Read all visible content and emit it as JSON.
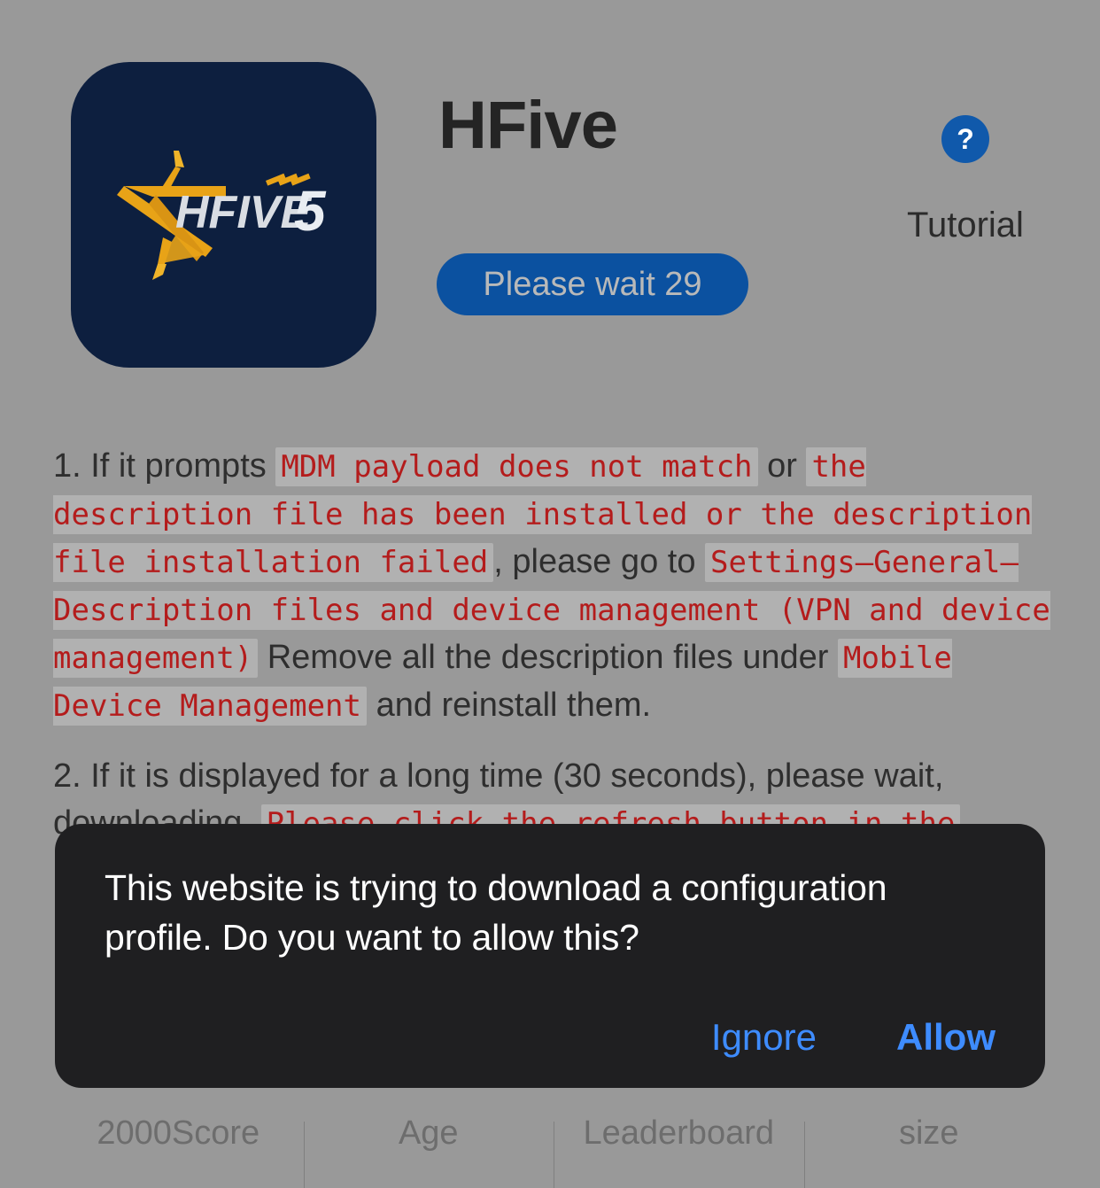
{
  "header": {
    "app_title": "HFive",
    "app_icon_name": "hfive5-logo",
    "icon_bg_color": "#0d1f3f",
    "icon_logo_text": "HFIVE",
    "icon_logo_number": "5",
    "wait_button_label": "Please wait 29",
    "wait_button_color": "#0b51a0",
    "help_icon_glyph": "?",
    "help_icon_color": "#1059ab",
    "tutorial_label": "Tutorial"
  },
  "instructions": {
    "item1": {
      "lead": "1. If it prompts",
      "code1": "MDM payload does not match",
      "conj": "or",
      "code2": "the description file has been installed or the description file installation failed",
      "mid1": ", please go to",
      "code3": "Settings—General—Description files and device management (VPN and device management)",
      "mid2": "Remove all the description files under",
      "code4": "Mobile Device Management",
      "tail": "and reinstall them."
    },
    "item2": {
      "lead": "2. If it is displayed for a long time (30 seconds), please wait, downloading.",
      "code1": "Please click the refresh button in the"
    }
  },
  "stats": {
    "columns": [
      {
        "label": "2000Score",
        "value": ""
      },
      {
        "label": "Age",
        "value": ""
      },
      {
        "label": "Leaderboard",
        "value": ""
      },
      {
        "label": "size",
        "value": ""
      }
    ]
  },
  "dialog": {
    "message": "This website is trying to download a configuration profile. Do you want to allow this?",
    "ignore_label": "Ignore",
    "allow_label": "Allow",
    "background_color": "#1f1f21",
    "action_color": "#3e8cff"
  }
}
